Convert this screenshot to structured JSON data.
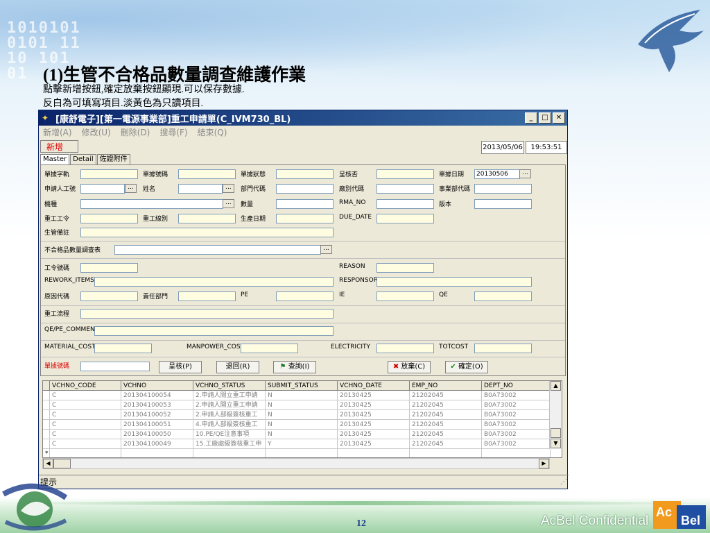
{
  "slide": {
    "title": "(1)生管不合格品數量調查維護作業",
    "line1": "點擊新增按鈕,確定放棄按鈕顯現.可以保存數據.",
    "line2": "反白為可填寫項目.淡黃色為只讀項目.",
    "page_number": "12",
    "confidential": "AcBel Confidential",
    "brand": "AcBel"
  },
  "window": {
    "title": "[康舒電子][第一電源事業部]重工申請單(C_IVM730_BL)",
    "minimize": "_",
    "maximize": "□",
    "close": "✕"
  },
  "menu": [
    "新增(A)",
    "修改(U)",
    "刪除(D)",
    "搜尋(F)",
    "結束(Q)"
  ],
  "status": {
    "mode": "新增",
    "date": "2013/05/06",
    "time": "19:53:51"
  },
  "tabs": [
    "Master",
    "Detail",
    "佐證附件"
  ],
  "form": {
    "doc_type": "單據字軌",
    "doc_no": "單據號碼",
    "doc_status": "單據狀態",
    "approve": "呈核否",
    "doc_date": "單據日期",
    "doc_date_value": "20130506",
    "applicant": "申請人工號",
    "name": "姓名",
    "dept_code": "部門代碼",
    "factory_code": "廠別代碼",
    "bu_code": "事業部代碼",
    "model": "機種",
    "qty": "數量",
    "rma_no": "RMA_NO",
    "version": "版本",
    "rework_order": "重工工令",
    "rework_line": "重工線別",
    "prod_date": "生產日期",
    "due_date": "DUE_DATE",
    "pc_note": "生管備註",
    "nc_survey": "不合格品數量調查表",
    "wo_no": "工令號碼",
    "reason": "REASON",
    "rework_items": "REWORK_ITEMS",
    "responsor": "RESPONSOR",
    "cause_code": "原因代碼",
    "resp_dept": "責任部門",
    "pe": "PE",
    "ie": "IE",
    "qe": "QE",
    "rework_flow": "重工流程",
    "qe_pe_comment": "QE/PE_COMMENT",
    "material_cost": "MATERIAL_COST",
    "manpower_cost": "MANPOWER_COST",
    "electricity": "ELECTRICITY",
    "totcost": "TOTCOST",
    "doc_no_query": "單據號碼"
  },
  "buttons": {
    "approve": "呈核(P)",
    "return": "退回(R)",
    "query": "查詢(I)",
    "abandon": "放棄(C)",
    "confirm": "確定(O)"
  },
  "grid": {
    "columns": [
      "VCHNO_CODE",
      "VCHNO",
      "VCHNO_STATUS",
      "SUBMIT_STATUS",
      "VCHNO_DATE",
      "EMP_NO",
      "DEPT_NO"
    ],
    "rows": [
      [
        "C",
        "201304100054",
        "2.申請人開立重工申請",
        "N",
        "20130425",
        "21202045",
        "B0A73002"
      ],
      [
        "C",
        "201304100053",
        "2.申請人開立重工申請",
        "N",
        "20130425",
        "21202045",
        "B0A73002"
      ],
      [
        "C",
        "201304100052",
        "2.申請人部級簽核重工",
        "N",
        "20130425",
        "21202045",
        "B0A73002"
      ],
      [
        "C",
        "201304100051",
        "4.申請人部級簽核重工",
        "N",
        "20130425",
        "21202045",
        "B0A73002"
      ],
      [
        "C",
        "201304100050",
        "10.PE/QE注意事項",
        "N",
        "20130425",
        "21202045",
        "B0A73002"
      ],
      [
        "C",
        "201304100049",
        "15.工廠處級簽核重工申",
        "Y",
        "20130425",
        "21202045",
        "B0A73002"
      ]
    ],
    "new_row_marker": "*"
  },
  "hint": "提示"
}
